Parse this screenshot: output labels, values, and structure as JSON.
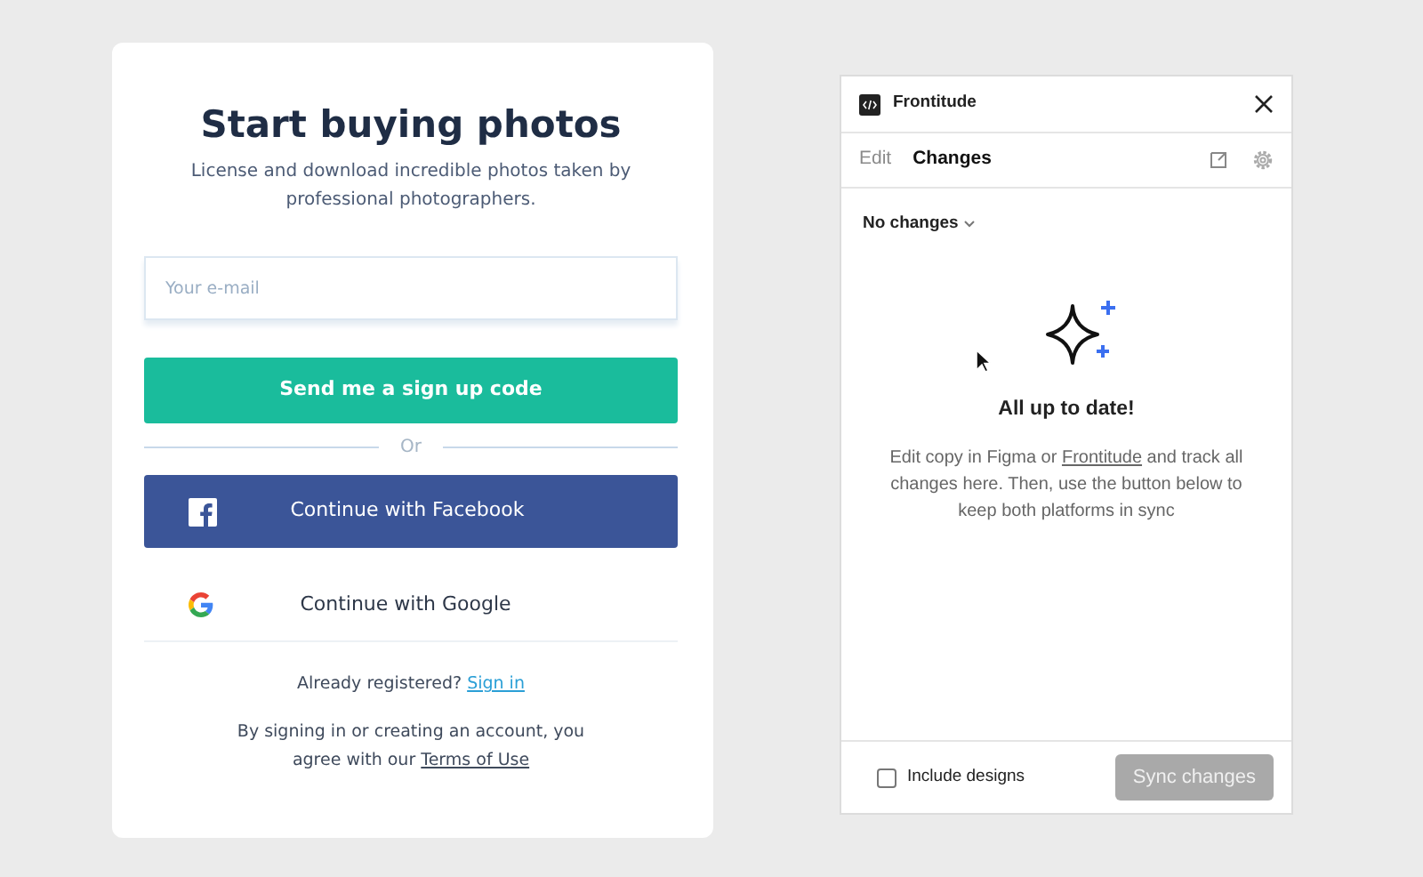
{
  "signup": {
    "title": "Start buying photos",
    "subtitle": "License and download incredible photos taken by professional photographers.",
    "email": {
      "placeholder": "Your e-mail"
    },
    "primary_button": "Send me a sign up code",
    "divider": "Or",
    "social_buttons": [
      {
        "kind": "facebook",
        "label": "Continue with Facebook"
      },
      {
        "kind": "google",
        "label": "Continue with Google"
      }
    ],
    "registered": {
      "text": "Already registered? ",
      "link": "Sign in"
    },
    "terms": {
      "text": "By signing in or creating an account, you agree with our ",
      "link": "Terms of Use"
    }
  },
  "plugin": {
    "title": "Frontitude",
    "tabs": [
      {
        "label": "Edit",
        "selected": false
      },
      {
        "label": "Changes",
        "selected": true
      }
    ],
    "filter": "No changes",
    "empty_title": "All up to date!",
    "empty_text": {
      "before": "Edit copy in Figma or ",
      "link": "Frontitude",
      "after": " and track all changes here. Then, use the button below to keep both platforms in sync"
    },
    "include_designs": {
      "label": "Include designs",
      "checked": false
    },
    "sync_button": {
      "label": "Sync changes",
      "disabled": true
    }
  }
}
